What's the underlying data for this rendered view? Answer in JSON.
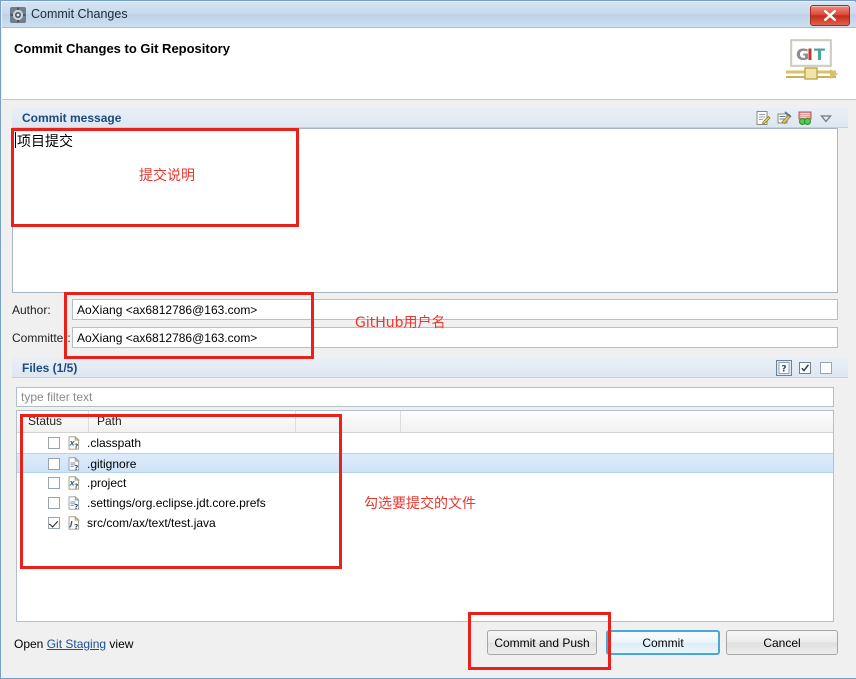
{
  "window": {
    "title": "Commit Changes",
    "title_icon": "commit-gear-icon",
    "close_label": "Close"
  },
  "header": {
    "title": "Commit Changes to Git Repository",
    "logo": {
      "name": "git-logo",
      "letters": [
        "G",
        "I",
        "T"
      ],
      "letter_colors": [
        "#8c8c8c",
        "#c0392b",
        "#4aa59b"
      ]
    }
  },
  "commit_message": {
    "section_title": "Commit message",
    "value": "项目提交",
    "tools": [
      {
        "name": "amend-icon",
        "label": "Amend previous commit"
      },
      {
        "name": "signed-off-icon",
        "label": "Add Signed-off-by"
      },
      {
        "name": "change-id-icon",
        "label": "Insert Change-Id"
      },
      {
        "name": "chevron-down-icon",
        "label": "More"
      }
    ]
  },
  "author": {
    "label": "Author:",
    "value": "AoXiang <ax6812786@163.com>"
  },
  "committer": {
    "label": "Committer:",
    "value": "AoXiang <ax6812786@163.com>"
  },
  "files": {
    "section_title": "Files (1/5)",
    "tools": [
      {
        "name": "show-untracked-icon",
        "label": "?"
      },
      {
        "name": "select-all-icon",
        "label": "Select all"
      },
      {
        "name": "deselect-all-icon",
        "label": "Deselect all"
      }
    ],
    "filter_placeholder": "type filter text",
    "filter_value": "",
    "columns": [
      {
        "key": "status",
        "label": "Status"
      },
      {
        "key": "path",
        "label": "Path"
      }
    ],
    "rows": [
      {
        "checked": false,
        "selected": false,
        "icon": "xml-file-unknown-icon",
        "path": ".classpath"
      },
      {
        "checked": false,
        "selected": true,
        "icon": "text-file-unknown-icon",
        "path": ".gitignore"
      },
      {
        "checked": false,
        "selected": false,
        "icon": "xml-file-unknown-icon",
        "path": ".project"
      },
      {
        "checked": false,
        "selected": false,
        "icon": "text-file-unknown-icon",
        "path": ".settings/org.eclipse.jdt.core.prefs"
      },
      {
        "checked": true,
        "selected": false,
        "icon": "java-file-unknown-icon",
        "path": "src/com/ax/text/test.java"
      }
    ]
  },
  "footer": {
    "open_prefix": "Open ",
    "link_label": "Git Staging",
    "open_suffix": " view",
    "buttons": [
      {
        "name": "commit-and-push",
        "label": "Commit and Push",
        "default": false
      },
      {
        "name": "commit",
        "label": "Commit",
        "default": true
      },
      {
        "name": "cancel",
        "label": "Cancel",
        "default": false
      }
    ]
  },
  "annotations": {
    "color": "#e8211a",
    "message_note": "提交说明",
    "author_note": "GitHub用户名",
    "files_note": "勾选要提交的文件"
  }
}
